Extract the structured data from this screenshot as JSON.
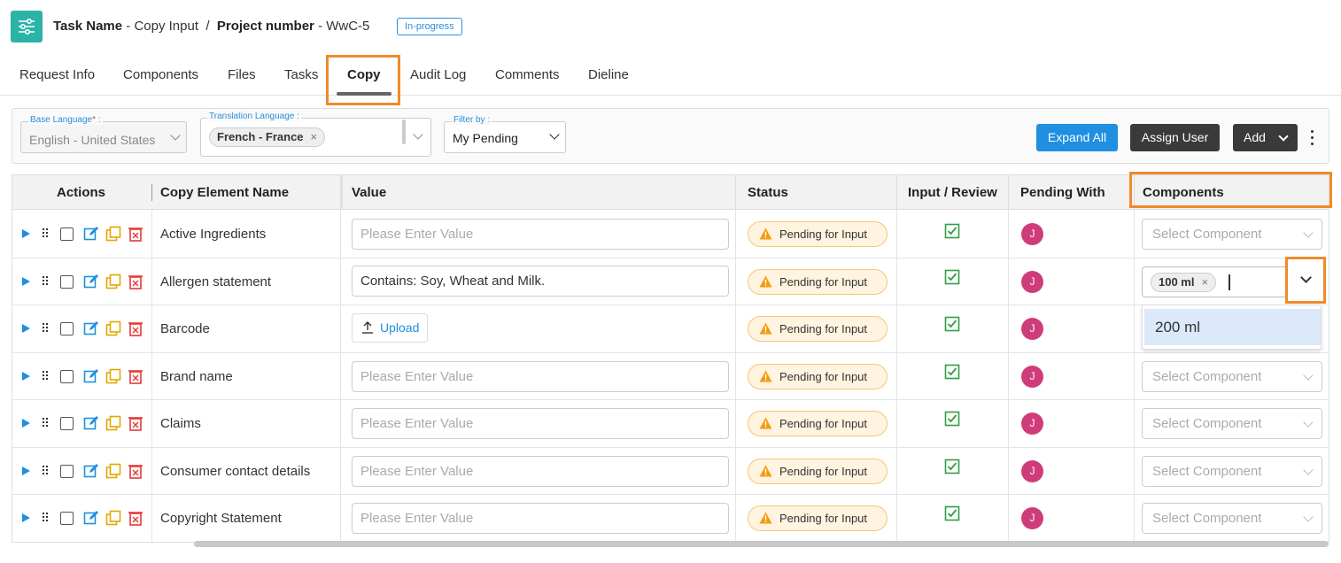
{
  "header": {
    "task_label": "Task Name",
    "task_value": "Copy Input",
    "separator": "/",
    "project_label": "Project number",
    "project_value": "WwC-5",
    "dash": "-",
    "status_badge": "In-progress",
    "icon": "sliders-icon"
  },
  "tabs": [
    "Request Info",
    "Components",
    "Files",
    "Tasks",
    "Copy",
    "Audit Log",
    "Comments",
    "Dieline"
  ],
  "active_tab": "Copy",
  "filters": {
    "base_language_label": "Base Language",
    "base_language_required": "*",
    "base_language_colon": ":",
    "base_language_value": "English - United States",
    "translation_language_label": "Translation Language :",
    "translation_language_chip": "French - France",
    "chip_remove": "×",
    "filter_by_label": "Filter by :",
    "filter_by_value": "My Pending"
  },
  "toolbar": {
    "expand_all": "Expand All",
    "assign_user": "Assign User",
    "add": "Add"
  },
  "table": {
    "columns": [
      "Actions",
      "Copy Element Name",
      "Value",
      "Status",
      "Input / Review",
      "Pending With",
      "Components"
    ],
    "value_placeholder": "Please Enter Value",
    "upload_label": "Upload",
    "status_text": "Pending for Input",
    "avatar_initial": "J",
    "component_placeholder": "Select Component",
    "rows": [
      {
        "name": "Active Ingredients",
        "value": "",
        "type": "input",
        "component": ""
      },
      {
        "name": "Allergen statement",
        "value": "Contains: Soy, Wheat and Milk.",
        "type": "input",
        "component": "100 ml"
      },
      {
        "name": "Barcode",
        "value": "",
        "type": "upload",
        "component": ""
      },
      {
        "name": "Brand name",
        "value": "",
        "type": "input",
        "component": ""
      },
      {
        "name": "Claims",
        "value": "",
        "type": "input",
        "component": ""
      },
      {
        "name": "Consumer contact details",
        "value": "",
        "type": "input",
        "component": ""
      },
      {
        "name": "Copyright Statement",
        "value": "",
        "type": "input",
        "component": ""
      }
    ]
  },
  "component_dropdown": {
    "selected_chip": "100 ml",
    "chip_remove": "×",
    "options": [
      "200 ml"
    ]
  },
  "colors": {
    "accent": "#1e8fe1",
    "teal": "#2ab3a6",
    "highlight": "#f08a2a",
    "avatar": "#cf3c7a",
    "status_bg": "#fff4df",
    "check": "#2f9e45"
  }
}
